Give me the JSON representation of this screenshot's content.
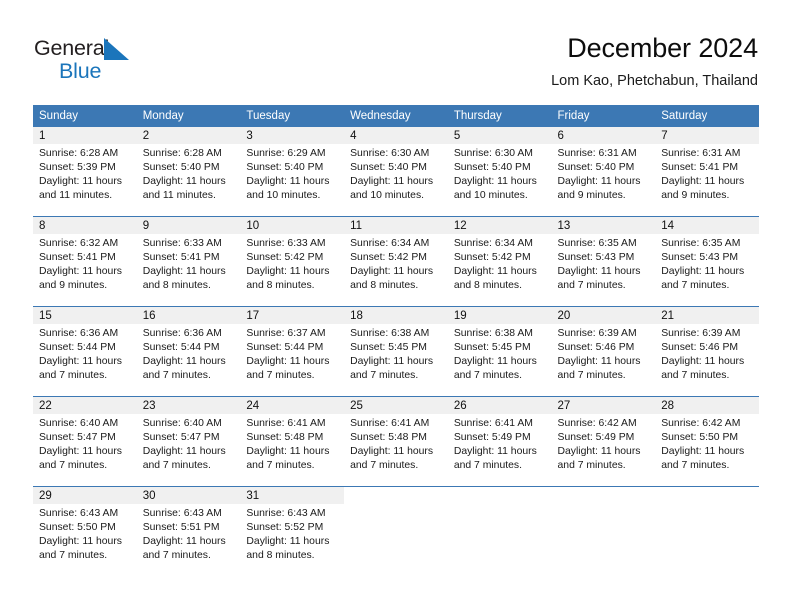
{
  "brand": {
    "name_part1": "General",
    "name_part2": "Blue",
    "triangle_icon": "blue-triangle-logo-mark",
    "accent_color": "#1b75bb"
  },
  "header": {
    "title": "December 2024",
    "subtitle": "Lom Kao, Phetchabun, Thailand"
  },
  "calendar": {
    "header_bg_color": "#3c78b4",
    "daynum_band_color": "#f0f0f0",
    "weekday_headers": [
      "Sunday",
      "Monday",
      "Tuesday",
      "Wednesday",
      "Thursday",
      "Friday",
      "Saturday"
    ],
    "weeks": [
      [
        {
          "day": "1",
          "sunrise": "Sunrise: 6:28 AM",
          "sunset": "Sunset: 5:39 PM",
          "daylight_line1": "Daylight: 11 hours",
          "daylight_line2": "and 11 minutes."
        },
        {
          "day": "2",
          "sunrise": "Sunrise: 6:28 AM",
          "sunset": "Sunset: 5:40 PM",
          "daylight_line1": "Daylight: 11 hours",
          "daylight_line2": "and 11 minutes."
        },
        {
          "day": "3",
          "sunrise": "Sunrise: 6:29 AM",
          "sunset": "Sunset: 5:40 PM",
          "daylight_line1": "Daylight: 11 hours",
          "daylight_line2": "and 10 minutes."
        },
        {
          "day": "4",
          "sunrise": "Sunrise: 6:30 AM",
          "sunset": "Sunset: 5:40 PM",
          "daylight_line1": "Daylight: 11 hours",
          "daylight_line2": "and 10 minutes."
        },
        {
          "day": "5",
          "sunrise": "Sunrise: 6:30 AM",
          "sunset": "Sunset: 5:40 PM",
          "daylight_line1": "Daylight: 11 hours",
          "daylight_line2": "and 10 minutes."
        },
        {
          "day": "6",
          "sunrise": "Sunrise: 6:31 AM",
          "sunset": "Sunset: 5:40 PM",
          "daylight_line1": "Daylight: 11 hours",
          "daylight_line2": "and 9 minutes."
        },
        {
          "day": "7",
          "sunrise": "Sunrise: 6:31 AM",
          "sunset": "Sunset: 5:41 PM",
          "daylight_line1": "Daylight: 11 hours",
          "daylight_line2": "and 9 minutes."
        }
      ],
      [
        {
          "day": "8",
          "sunrise": "Sunrise: 6:32 AM",
          "sunset": "Sunset: 5:41 PM",
          "daylight_line1": "Daylight: 11 hours",
          "daylight_line2": "and 9 minutes."
        },
        {
          "day": "9",
          "sunrise": "Sunrise: 6:33 AM",
          "sunset": "Sunset: 5:41 PM",
          "daylight_line1": "Daylight: 11 hours",
          "daylight_line2": "and 8 minutes."
        },
        {
          "day": "10",
          "sunrise": "Sunrise: 6:33 AM",
          "sunset": "Sunset: 5:42 PM",
          "daylight_line1": "Daylight: 11 hours",
          "daylight_line2": "and 8 minutes."
        },
        {
          "day": "11",
          "sunrise": "Sunrise: 6:34 AM",
          "sunset": "Sunset: 5:42 PM",
          "daylight_line1": "Daylight: 11 hours",
          "daylight_line2": "and 8 minutes."
        },
        {
          "day": "12",
          "sunrise": "Sunrise: 6:34 AM",
          "sunset": "Sunset: 5:42 PM",
          "daylight_line1": "Daylight: 11 hours",
          "daylight_line2": "and 8 minutes."
        },
        {
          "day": "13",
          "sunrise": "Sunrise: 6:35 AM",
          "sunset": "Sunset: 5:43 PM",
          "daylight_line1": "Daylight: 11 hours",
          "daylight_line2": "and 7 minutes."
        },
        {
          "day": "14",
          "sunrise": "Sunrise: 6:35 AM",
          "sunset": "Sunset: 5:43 PM",
          "daylight_line1": "Daylight: 11 hours",
          "daylight_line2": "and 7 minutes."
        }
      ],
      [
        {
          "day": "15",
          "sunrise": "Sunrise: 6:36 AM",
          "sunset": "Sunset: 5:44 PM",
          "daylight_line1": "Daylight: 11 hours",
          "daylight_line2": "and 7 minutes."
        },
        {
          "day": "16",
          "sunrise": "Sunrise: 6:36 AM",
          "sunset": "Sunset: 5:44 PM",
          "daylight_line1": "Daylight: 11 hours",
          "daylight_line2": "and 7 minutes."
        },
        {
          "day": "17",
          "sunrise": "Sunrise: 6:37 AM",
          "sunset": "Sunset: 5:44 PM",
          "daylight_line1": "Daylight: 11 hours",
          "daylight_line2": "and 7 minutes."
        },
        {
          "day": "18",
          "sunrise": "Sunrise: 6:38 AM",
          "sunset": "Sunset: 5:45 PM",
          "daylight_line1": "Daylight: 11 hours",
          "daylight_line2": "and 7 minutes."
        },
        {
          "day": "19",
          "sunrise": "Sunrise: 6:38 AM",
          "sunset": "Sunset: 5:45 PM",
          "daylight_line1": "Daylight: 11 hours",
          "daylight_line2": "and 7 minutes."
        },
        {
          "day": "20",
          "sunrise": "Sunrise: 6:39 AM",
          "sunset": "Sunset: 5:46 PM",
          "daylight_line1": "Daylight: 11 hours",
          "daylight_line2": "and 7 minutes."
        },
        {
          "day": "21",
          "sunrise": "Sunrise: 6:39 AM",
          "sunset": "Sunset: 5:46 PM",
          "daylight_line1": "Daylight: 11 hours",
          "daylight_line2": "and 7 minutes."
        }
      ],
      [
        {
          "day": "22",
          "sunrise": "Sunrise: 6:40 AM",
          "sunset": "Sunset: 5:47 PM",
          "daylight_line1": "Daylight: 11 hours",
          "daylight_line2": "and 7 minutes."
        },
        {
          "day": "23",
          "sunrise": "Sunrise: 6:40 AM",
          "sunset": "Sunset: 5:47 PM",
          "daylight_line1": "Daylight: 11 hours",
          "daylight_line2": "and 7 minutes."
        },
        {
          "day": "24",
          "sunrise": "Sunrise: 6:41 AM",
          "sunset": "Sunset: 5:48 PM",
          "daylight_line1": "Daylight: 11 hours",
          "daylight_line2": "and 7 minutes."
        },
        {
          "day": "25",
          "sunrise": "Sunrise: 6:41 AM",
          "sunset": "Sunset: 5:48 PM",
          "daylight_line1": "Daylight: 11 hours",
          "daylight_line2": "and 7 minutes."
        },
        {
          "day": "26",
          "sunrise": "Sunrise: 6:41 AM",
          "sunset": "Sunset: 5:49 PM",
          "daylight_line1": "Daylight: 11 hours",
          "daylight_line2": "and 7 minutes."
        },
        {
          "day": "27",
          "sunrise": "Sunrise: 6:42 AM",
          "sunset": "Sunset: 5:49 PM",
          "daylight_line1": "Daylight: 11 hours",
          "daylight_line2": "and 7 minutes."
        },
        {
          "day": "28",
          "sunrise": "Sunrise: 6:42 AM",
          "sunset": "Sunset: 5:50 PM",
          "daylight_line1": "Daylight: 11 hours",
          "daylight_line2": "and 7 minutes."
        }
      ],
      [
        {
          "day": "29",
          "sunrise": "Sunrise: 6:43 AM",
          "sunset": "Sunset: 5:50 PM",
          "daylight_line1": "Daylight: 11 hours",
          "daylight_line2": "and 7 minutes."
        },
        {
          "day": "30",
          "sunrise": "Sunrise: 6:43 AM",
          "sunset": "Sunset: 5:51 PM",
          "daylight_line1": "Daylight: 11 hours",
          "daylight_line2": "and 7 minutes."
        },
        {
          "day": "31",
          "sunrise": "Sunrise: 6:43 AM",
          "sunset": "Sunset: 5:52 PM",
          "daylight_line1": "Daylight: 11 hours",
          "daylight_line2": "and 8 minutes."
        },
        {
          "day": "",
          "sunrise": "",
          "sunset": "",
          "daylight_line1": "",
          "daylight_line2": ""
        },
        {
          "day": "",
          "sunrise": "",
          "sunset": "",
          "daylight_line1": "",
          "daylight_line2": ""
        },
        {
          "day": "",
          "sunrise": "",
          "sunset": "",
          "daylight_line1": "",
          "daylight_line2": ""
        },
        {
          "day": "",
          "sunrise": "",
          "sunset": "",
          "daylight_line1": "",
          "daylight_line2": ""
        }
      ]
    ]
  }
}
